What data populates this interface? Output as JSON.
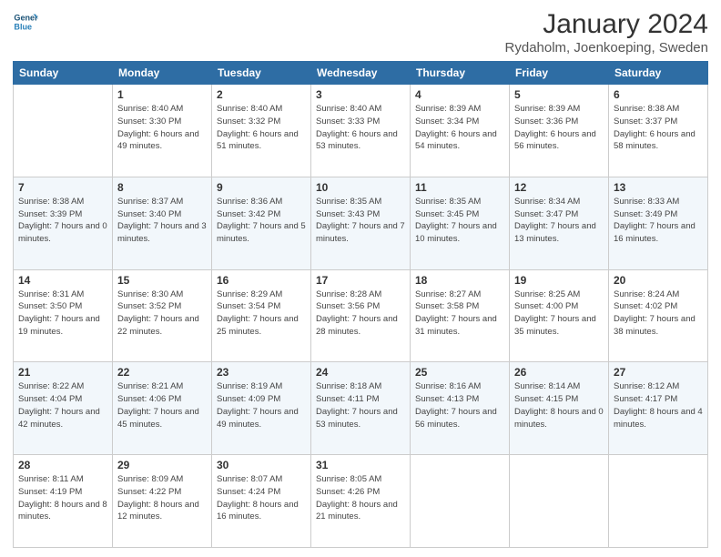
{
  "logo": {
    "line1": "General",
    "line2": "Blue"
  },
  "title": "January 2024",
  "subtitle": "Rydaholm, Joenkoeping, Sweden",
  "days_of_week": [
    "Sunday",
    "Monday",
    "Tuesday",
    "Wednesday",
    "Thursday",
    "Friday",
    "Saturday"
  ],
  "weeks": [
    [
      {
        "day": "",
        "sunrise": "",
        "sunset": "",
        "daylight": ""
      },
      {
        "day": "1",
        "sunrise": "Sunrise: 8:40 AM",
        "sunset": "Sunset: 3:30 PM",
        "daylight": "Daylight: 6 hours and 49 minutes."
      },
      {
        "day": "2",
        "sunrise": "Sunrise: 8:40 AM",
        "sunset": "Sunset: 3:32 PM",
        "daylight": "Daylight: 6 hours and 51 minutes."
      },
      {
        "day": "3",
        "sunrise": "Sunrise: 8:40 AM",
        "sunset": "Sunset: 3:33 PM",
        "daylight": "Daylight: 6 hours and 53 minutes."
      },
      {
        "day": "4",
        "sunrise": "Sunrise: 8:39 AM",
        "sunset": "Sunset: 3:34 PM",
        "daylight": "Daylight: 6 hours and 54 minutes."
      },
      {
        "day": "5",
        "sunrise": "Sunrise: 8:39 AM",
        "sunset": "Sunset: 3:36 PM",
        "daylight": "Daylight: 6 hours and 56 minutes."
      },
      {
        "day": "6",
        "sunrise": "Sunrise: 8:38 AM",
        "sunset": "Sunset: 3:37 PM",
        "daylight": "Daylight: 6 hours and 58 minutes."
      }
    ],
    [
      {
        "day": "7",
        "sunrise": "Sunrise: 8:38 AM",
        "sunset": "Sunset: 3:39 PM",
        "daylight": "Daylight: 7 hours and 0 minutes."
      },
      {
        "day": "8",
        "sunrise": "Sunrise: 8:37 AM",
        "sunset": "Sunset: 3:40 PM",
        "daylight": "Daylight: 7 hours and 3 minutes."
      },
      {
        "day": "9",
        "sunrise": "Sunrise: 8:36 AM",
        "sunset": "Sunset: 3:42 PM",
        "daylight": "Daylight: 7 hours and 5 minutes."
      },
      {
        "day": "10",
        "sunrise": "Sunrise: 8:35 AM",
        "sunset": "Sunset: 3:43 PM",
        "daylight": "Daylight: 7 hours and 7 minutes."
      },
      {
        "day": "11",
        "sunrise": "Sunrise: 8:35 AM",
        "sunset": "Sunset: 3:45 PM",
        "daylight": "Daylight: 7 hours and 10 minutes."
      },
      {
        "day": "12",
        "sunrise": "Sunrise: 8:34 AM",
        "sunset": "Sunset: 3:47 PM",
        "daylight": "Daylight: 7 hours and 13 minutes."
      },
      {
        "day": "13",
        "sunrise": "Sunrise: 8:33 AM",
        "sunset": "Sunset: 3:49 PM",
        "daylight": "Daylight: 7 hours and 16 minutes."
      }
    ],
    [
      {
        "day": "14",
        "sunrise": "Sunrise: 8:31 AM",
        "sunset": "Sunset: 3:50 PM",
        "daylight": "Daylight: 7 hours and 19 minutes."
      },
      {
        "day": "15",
        "sunrise": "Sunrise: 8:30 AM",
        "sunset": "Sunset: 3:52 PM",
        "daylight": "Daylight: 7 hours and 22 minutes."
      },
      {
        "day": "16",
        "sunrise": "Sunrise: 8:29 AM",
        "sunset": "Sunset: 3:54 PM",
        "daylight": "Daylight: 7 hours and 25 minutes."
      },
      {
        "day": "17",
        "sunrise": "Sunrise: 8:28 AM",
        "sunset": "Sunset: 3:56 PM",
        "daylight": "Daylight: 7 hours and 28 minutes."
      },
      {
        "day": "18",
        "sunrise": "Sunrise: 8:27 AM",
        "sunset": "Sunset: 3:58 PM",
        "daylight": "Daylight: 7 hours and 31 minutes."
      },
      {
        "day": "19",
        "sunrise": "Sunrise: 8:25 AM",
        "sunset": "Sunset: 4:00 PM",
        "daylight": "Daylight: 7 hours and 35 minutes."
      },
      {
        "day": "20",
        "sunrise": "Sunrise: 8:24 AM",
        "sunset": "Sunset: 4:02 PM",
        "daylight": "Daylight: 7 hours and 38 minutes."
      }
    ],
    [
      {
        "day": "21",
        "sunrise": "Sunrise: 8:22 AM",
        "sunset": "Sunset: 4:04 PM",
        "daylight": "Daylight: 7 hours and 42 minutes."
      },
      {
        "day": "22",
        "sunrise": "Sunrise: 8:21 AM",
        "sunset": "Sunset: 4:06 PM",
        "daylight": "Daylight: 7 hours and 45 minutes."
      },
      {
        "day": "23",
        "sunrise": "Sunrise: 8:19 AM",
        "sunset": "Sunset: 4:09 PM",
        "daylight": "Daylight: 7 hours and 49 minutes."
      },
      {
        "day": "24",
        "sunrise": "Sunrise: 8:18 AM",
        "sunset": "Sunset: 4:11 PM",
        "daylight": "Daylight: 7 hours and 53 minutes."
      },
      {
        "day": "25",
        "sunrise": "Sunrise: 8:16 AM",
        "sunset": "Sunset: 4:13 PM",
        "daylight": "Daylight: 7 hours and 56 minutes."
      },
      {
        "day": "26",
        "sunrise": "Sunrise: 8:14 AM",
        "sunset": "Sunset: 4:15 PM",
        "daylight": "Daylight: 8 hours and 0 minutes."
      },
      {
        "day": "27",
        "sunrise": "Sunrise: 8:12 AM",
        "sunset": "Sunset: 4:17 PM",
        "daylight": "Daylight: 8 hours and 4 minutes."
      }
    ],
    [
      {
        "day": "28",
        "sunrise": "Sunrise: 8:11 AM",
        "sunset": "Sunset: 4:19 PM",
        "daylight": "Daylight: 8 hours and 8 minutes."
      },
      {
        "day": "29",
        "sunrise": "Sunrise: 8:09 AM",
        "sunset": "Sunset: 4:22 PM",
        "daylight": "Daylight: 8 hours and 12 minutes."
      },
      {
        "day": "30",
        "sunrise": "Sunrise: 8:07 AM",
        "sunset": "Sunset: 4:24 PM",
        "daylight": "Daylight: 8 hours and 16 minutes."
      },
      {
        "day": "31",
        "sunrise": "Sunrise: 8:05 AM",
        "sunset": "Sunset: 4:26 PM",
        "daylight": "Daylight: 8 hours and 21 minutes."
      },
      {
        "day": "",
        "sunrise": "",
        "sunset": "",
        "daylight": ""
      },
      {
        "day": "",
        "sunrise": "",
        "sunset": "",
        "daylight": ""
      },
      {
        "day": "",
        "sunrise": "",
        "sunset": "",
        "daylight": ""
      }
    ]
  ]
}
